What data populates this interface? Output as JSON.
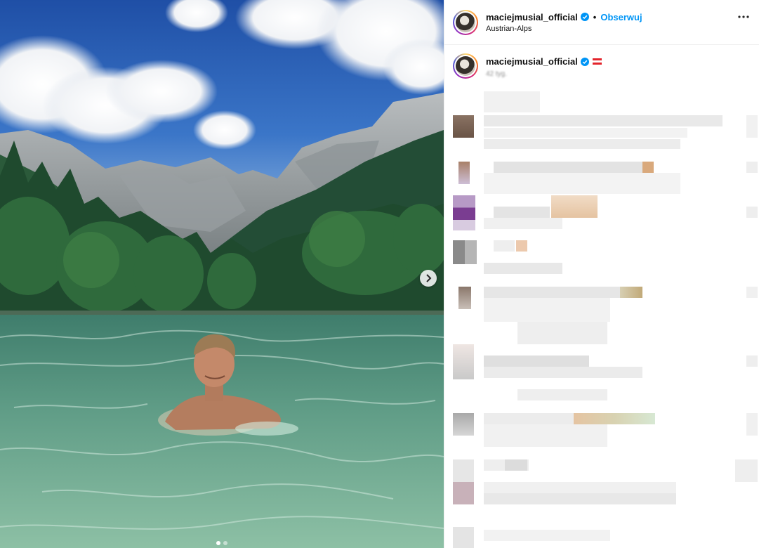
{
  "post": {
    "username": "maciejmusial_official",
    "separator": "•",
    "follow_label": "Obserwuj",
    "location": "Austrian-Alps",
    "caption_username": "maciejmusial_official",
    "time_ago": "42 tyg.",
    "carousel": {
      "total_images": 2,
      "current_index": 1
    }
  },
  "icons": {
    "verified": "verified-badge-icon",
    "flag": "austria-flag-icon",
    "more": "more-options-icon",
    "next": "chevron-right-icon"
  },
  "colors": {
    "accent": "#0095f6",
    "text": "#111111",
    "muted": "#8e8e8e",
    "divider": "#efefef"
  },
  "comments": {
    "pixelated": true,
    "count_visible": 10
  }
}
